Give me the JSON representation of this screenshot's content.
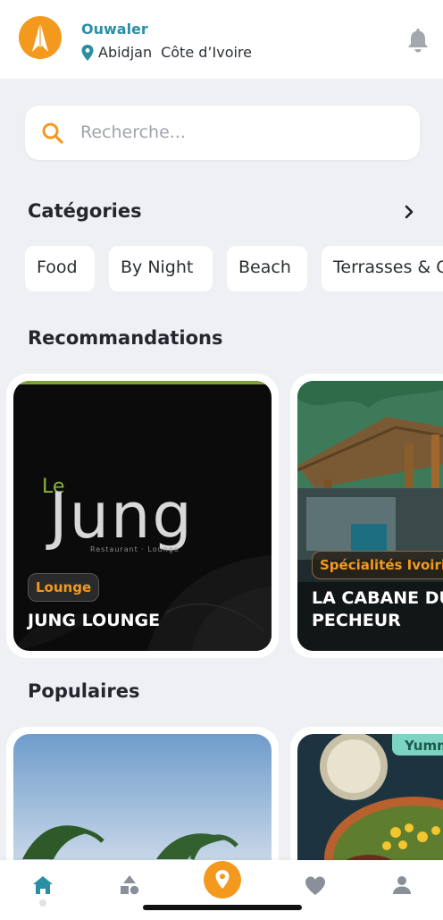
{
  "header": {
    "app_name": "Ouwaler",
    "city": "Abidjan",
    "country": "Côte d’Ivoire"
  },
  "search": {
    "placeholder": "Recherche..."
  },
  "categories": {
    "title": "Catégories",
    "items": [
      "Food",
      "By Night",
      "Beach",
      "Terrasses & Cafés"
    ]
  },
  "recommendations": {
    "title": "Recommandations",
    "cards": [
      {
        "badge": "Lounge",
        "title": "JUNG LOUNGE",
        "logo_prefix": "Le",
        "logo_text": "Jung",
        "logo_tagline": "Restaurant · Lounge"
      },
      {
        "badge": "Spécialités Ivoiriennes",
        "title_line1": "LA CABANE DU",
        "title_line2": "PECHEUR"
      }
    ]
  },
  "populaires": {
    "title": "Populaires",
    "cards": [
      {
        "image": "beach-palms"
      },
      {
        "badge": "Yumm"
      }
    ]
  },
  "bottom_nav": {
    "items": [
      "home-icon",
      "categories-icon",
      "map-pin-icon",
      "heart-icon",
      "profile-icon"
    ],
    "active": "home-icon"
  },
  "colors": {
    "brand": "#f39a1e",
    "app_name": "#2b8fa3",
    "background": "#eef0f3",
    "active_nav": "#2b8fa3",
    "inactive_nav": "#8a9099"
  }
}
